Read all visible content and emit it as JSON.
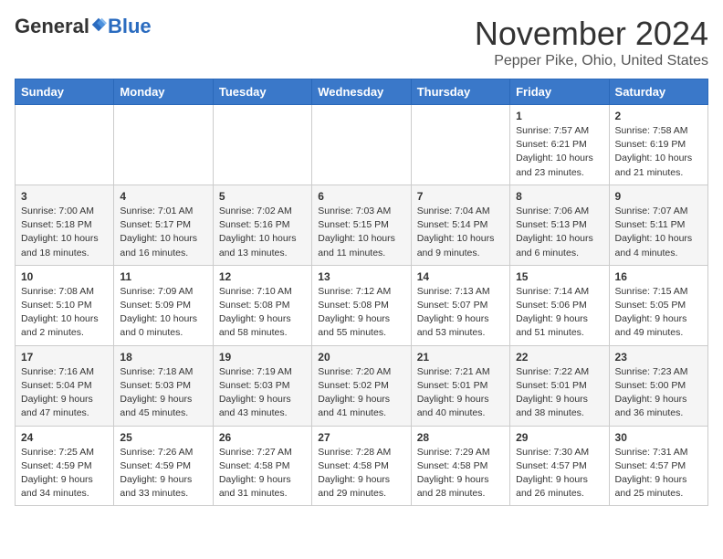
{
  "header": {
    "logo_general": "General",
    "logo_blue": "Blue",
    "month_title": "November 2024",
    "location": "Pepper Pike, Ohio, United States"
  },
  "weekdays": [
    "Sunday",
    "Monday",
    "Tuesday",
    "Wednesday",
    "Thursday",
    "Friday",
    "Saturday"
  ],
  "weeks": [
    [
      {
        "day": "",
        "detail": ""
      },
      {
        "day": "",
        "detail": ""
      },
      {
        "day": "",
        "detail": ""
      },
      {
        "day": "",
        "detail": ""
      },
      {
        "day": "",
        "detail": ""
      },
      {
        "day": "1",
        "detail": "Sunrise: 7:57 AM\nSunset: 6:21 PM\nDaylight: 10 hours and 23 minutes."
      },
      {
        "day": "2",
        "detail": "Sunrise: 7:58 AM\nSunset: 6:19 PM\nDaylight: 10 hours and 21 minutes."
      }
    ],
    [
      {
        "day": "3",
        "detail": "Sunrise: 7:00 AM\nSunset: 5:18 PM\nDaylight: 10 hours and 18 minutes."
      },
      {
        "day": "4",
        "detail": "Sunrise: 7:01 AM\nSunset: 5:17 PM\nDaylight: 10 hours and 16 minutes."
      },
      {
        "day": "5",
        "detail": "Sunrise: 7:02 AM\nSunset: 5:16 PM\nDaylight: 10 hours and 13 minutes."
      },
      {
        "day": "6",
        "detail": "Sunrise: 7:03 AM\nSunset: 5:15 PM\nDaylight: 10 hours and 11 minutes."
      },
      {
        "day": "7",
        "detail": "Sunrise: 7:04 AM\nSunset: 5:14 PM\nDaylight: 10 hours and 9 minutes."
      },
      {
        "day": "8",
        "detail": "Sunrise: 7:06 AM\nSunset: 5:13 PM\nDaylight: 10 hours and 6 minutes."
      },
      {
        "day": "9",
        "detail": "Sunrise: 7:07 AM\nSunset: 5:11 PM\nDaylight: 10 hours and 4 minutes."
      }
    ],
    [
      {
        "day": "10",
        "detail": "Sunrise: 7:08 AM\nSunset: 5:10 PM\nDaylight: 10 hours and 2 minutes."
      },
      {
        "day": "11",
        "detail": "Sunrise: 7:09 AM\nSunset: 5:09 PM\nDaylight: 10 hours and 0 minutes."
      },
      {
        "day": "12",
        "detail": "Sunrise: 7:10 AM\nSunset: 5:08 PM\nDaylight: 9 hours and 58 minutes."
      },
      {
        "day": "13",
        "detail": "Sunrise: 7:12 AM\nSunset: 5:08 PM\nDaylight: 9 hours and 55 minutes."
      },
      {
        "day": "14",
        "detail": "Sunrise: 7:13 AM\nSunset: 5:07 PM\nDaylight: 9 hours and 53 minutes."
      },
      {
        "day": "15",
        "detail": "Sunrise: 7:14 AM\nSunset: 5:06 PM\nDaylight: 9 hours and 51 minutes."
      },
      {
        "day": "16",
        "detail": "Sunrise: 7:15 AM\nSunset: 5:05 PM\nDaylight: 9 hours and 49 minutes."
      }
    ],
    [
      {
        "day": "17",
        "detail": "Sunrise: 7:16 AM\nSunset: 5:04 PM\nDaylight: 9 hours and 47 minutes."
      },
      {
        "day": "18",
        "detail": "Sunrise: 7:18 AM\nSunset: 5:03 PM\nDaylight: 9 hours and 45 minutes."
      },
      {
        "day": "19",
        "detail": "Sunrise: 7:19 AM\nSunset: 5:03 PM\nDaylight: 9 hours and 43 minutes."
      },
      {
        "day": "20",
        "detail": "Sunrise: 7:20 AM\nSunset: 5:02 PM\nDaylight: 9 hours and 41 minutes."
      },
      {
        "day": "21",
        "detail": "Sunrise: 7:21 AM\nSunset: 5:01 PM\nDaylight: 9 hours and 40 minutes."
      },
      {
        "day": "22",
        "detail": "Sunrise: 7:22 AM\nSunset: 5:01 PM\nDaylight: 9 hours and 38 minutes."
      },
      {
        "day": "23",
        "detail": "Sunrise: 7:23 AM\nSunset: 5:00 PM\nDaylight: 9 hours and 36 minutes."
      }
    ],
    [
      {
        "day": "24",
        "detail": "Sunrise: 7:25 AM\nSunset: 4:59 PM\nDaylight: 9 hours and 34 minutes."
      },
      {
        "day": "25",
        "detail": "Sunrise: 7:26 AM\nSunset: 4:59 PM\nDaylight: 9 hours and 33 minutes."
      },
      {
        "day": "26",
        "detail": "Sunrise: 7:27 AM\nSunset: 4:58 PM\nDaylight: 9 hours and 31 minutes."
      },
      {
        "day": "27",
        "detail": "Sunrise: 7:28 AM\nSunset: 4:58 PM\nDaylight: 9 hours and 29 minutes."
      },
      {
        "day": "28",
        "detail": "Sunrise: 7:29 AM\nSunset: 4:58 PM\nDaylight: 9 hours and 28 minutes."
      },
      {
        "day": "29",
        "detail": "Sunrise: 7:30 AM\nSunset: 4:57 PM\nDaylight: 9 hours and 26 minutes."
      },
      {
        "day": "30",
        "detail": "Sunrise: 7:31 AM\nSunset: 4:57 PM\nDaylight: 9 hours and 25 minutes."
      }
    ]
  ]
}
